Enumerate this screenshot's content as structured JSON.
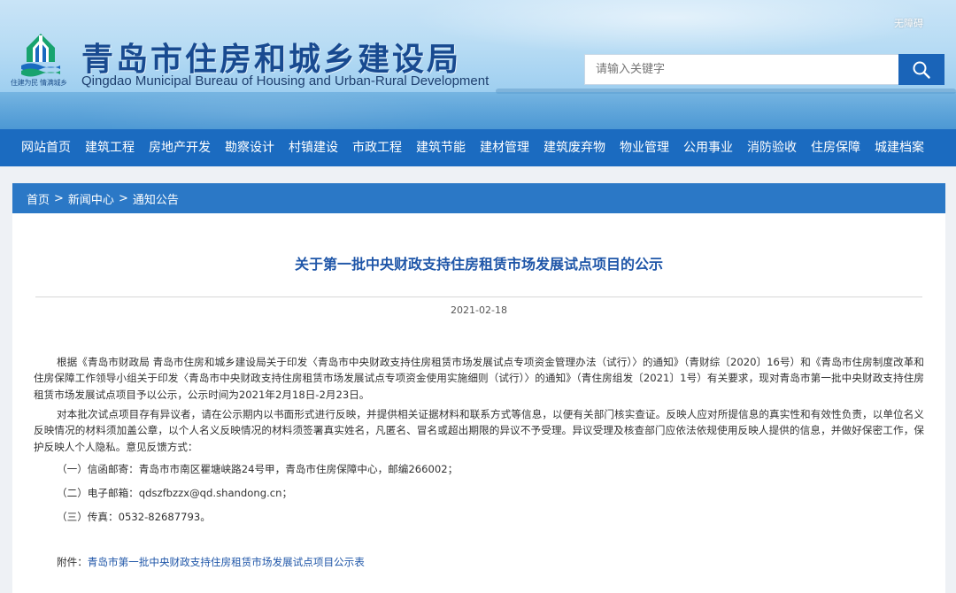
{
  "header": {
    "logo_slogan": "住建为民 情满城乡",
    "title_cn": "青岛市住房和城乡建设局",
    "title_en": "Qingdao Municipal Bureau of Housing and Urban-Rural Development",
    "accessibility_label": "无障碍",
    "search_placeholder": "请输入关键字"
  },
  "nav": {
    "items": [
      "网站首页",
      "建筑工程",
      "房地产开发",
      "勘察设计",
      "村镇建设",
      "市政工程",
      "建筑节能",
      "建材管理",
      "建筑废弃物",
      "物业管理",
      "公用事业",
      "消防验收",
      "住房保障",
      "城建档案"
    ]
  },
  "breadcrumb": {
    "items": [
      "首页",
      "新闻中心",
      "通知公告"
    ],
    "separator": ">"
  },
  "article": {
    "title": "关于第一批中央财政支持住房租赁市场发展试点项目的公示",
    "date": "2021-02-18",
    "paragraph1": "根据《青岛市财政局 青岛市住房和城乡建设局关于印发〈青岛市中央财政支持住房租赁市场发展试点专项资金管理办法（试行）〉的通知》（青财综〔2020〕16号）和《青岛市住房制度改革和住房保障工作领导小组关于印发〈青岛市中央财政支持住房租赁市场发展试点专项资金使用实施细则（试行）〉的通知》（青住房组发〔2021〕1号）有关要求，现对青岛市第一批中央财政支持住房租赁市场发展试点项目予以公示，公示时间为2021年2月18日-2月23日。",
    "paragraph2": "对本批次试点项目存有异议者，请在公示期内以书面形式进行反映，并提供相关证据材料和联系方式等信息，以便有关部门核实查证。反映人应对所提信息的真实性和有效性负责，以单位名义反映情况的材料须加盖公章，以个人名义反映情况的材料须签署真实姓名，凡匿名、冒名或超出期限的异议不予受理。异议受理及核查部门应依法依规使用反映人提供的信息，并做好保密工作，保护反映人个人隐私。意见反馈方式：",
    "contact_items": [
      "（一）信函邮寄：青岛市市南区瞿塘峡路24号甲，青岛市住房保障中心，邮编266002；",
      "（二）电子邮箱：qdszfbzzx@qd.shandong.cn；",
      "（三）传真：0532-82687793。"
    ],
    "attachment_label": "附件：",
    "attachment_link": "青岛市第一批中央财政支持住房租赁市场发展试点项目公示表"
  },
  "colors": {
    "nav_bg": "#1b6bc0",
    "crumb_bg": "#2b78c6",
    "title_blue": "#1f56a8",
    "search_btn": "#1a64b8"
  },
  "icons": {
    "logo": "bureau-logo-icon",
    "search": "search-icon"
  }
}
